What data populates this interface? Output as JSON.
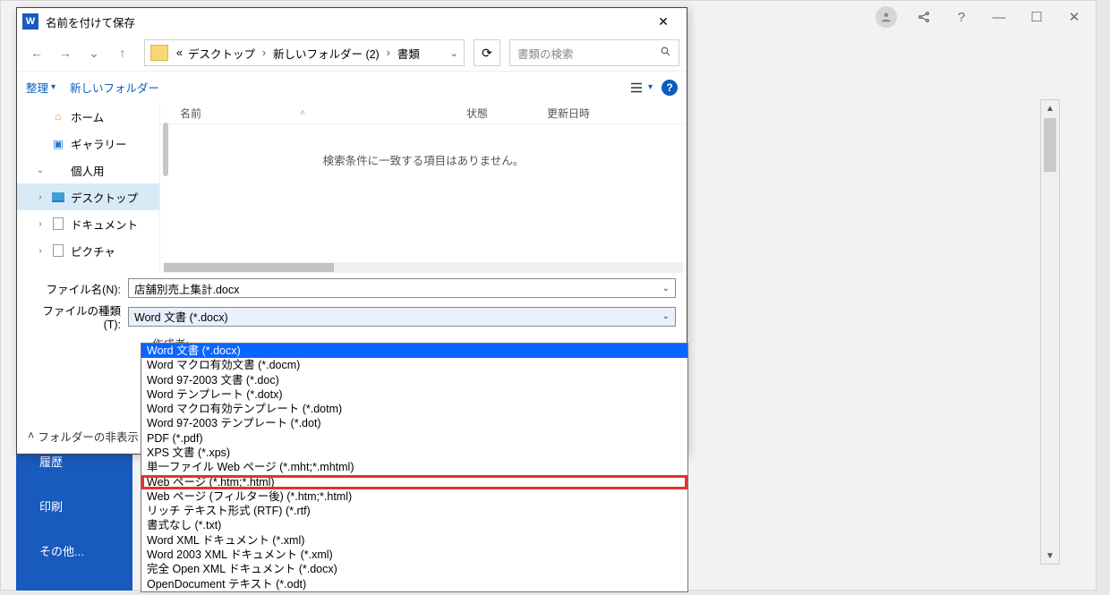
{
  "app_titlebar": {
    "avatar": "avatar",
    "share_icon": "share-icon",
    "help": "?",
    "minimize": "—",
    "maximize": "☐",
    "close": "✕"
  },
  "backstage": {
    "history": "履歴",
    "print": "印刷",
    "other": "その他..."
  },
  "dialog": {
    "title": "名前を付けて保存",
    "close": "✕",
    "nav": {
      "back": "←",
      "forward": "→",
      "recent": "⌄",
      "up": "↑",
      "refresh": "⟳"
    },
    "breadcrumb": {
      "more": "«",
      "p1": "デスクトップ",
      "p2": "新しいフォルダー (2)",
      "p3": "書類",
      "sep": "›",
      "drop": "⌄"
    },
    "search_placeholder": "書類の検索",
    "toolbar": {
      "organize": "整理",
      "new_folder": "新しいフォルダー"
    },
    "help": "?",
    "tree": {
      "home": "ホーム",
      "gallery": "ギャラリー",
      "personal": "個人用",
      "desktop": "デスクトップ",
      "documents": "ドキュメント",
      "pictures": "ピクチャ"
    },
    "columns": {
      "name": "名前",
      "status": "状態",
      "date": "更新日時"
    },
    "empty_msg": "検索条件に一致する項目はありません。",
    "filename_label": "ファイル名(N):",
    "filename_value": "店舗別売上集計.docx",
    "filetype_label": "ファイルの種類(T):",
    "filetype_value": "Word 文書 (*.docx)",
    "author_label": "作成者:",
    "folder_hide": "フォルダーの非表示"
  },
  "filetypes": [
    "Word 文書 (*.docx)",
    "Word マクロ有効文書 (*.docm)",
    "Word 97-2003 文書 (*.doc)",
    "Word テンプレート (*.dotx)",
    "Word マクロ有効テンプレート (*.dotm)",
    "Word 97-2003 テンプレート (*.dot)",
    "PDF (*.pdf)",
    "XPS 文書 (*.xps)",
    "単一ファイル Web ページ (*.mht;*.mhtml)",
    "Web ページ (*.htm;*.html)",
    "Web ページ (フィルター後) (*.htm;*.html)",
    "リッチ テキスト形式 (RTF) (*.rtf)",
    "書式なし (*.txt)",
    "Word XML ドキュメント (*.xml)",
    "Word 2003 XML ドキュメント (*.xml)",
    "完全 Open XML ドキュメント (*.docx)",
    "OpenDocument テキスト (*.odt)"
  ],
  "filetype_selected_index": 0,
  "filetype_callout_index": 9
}
